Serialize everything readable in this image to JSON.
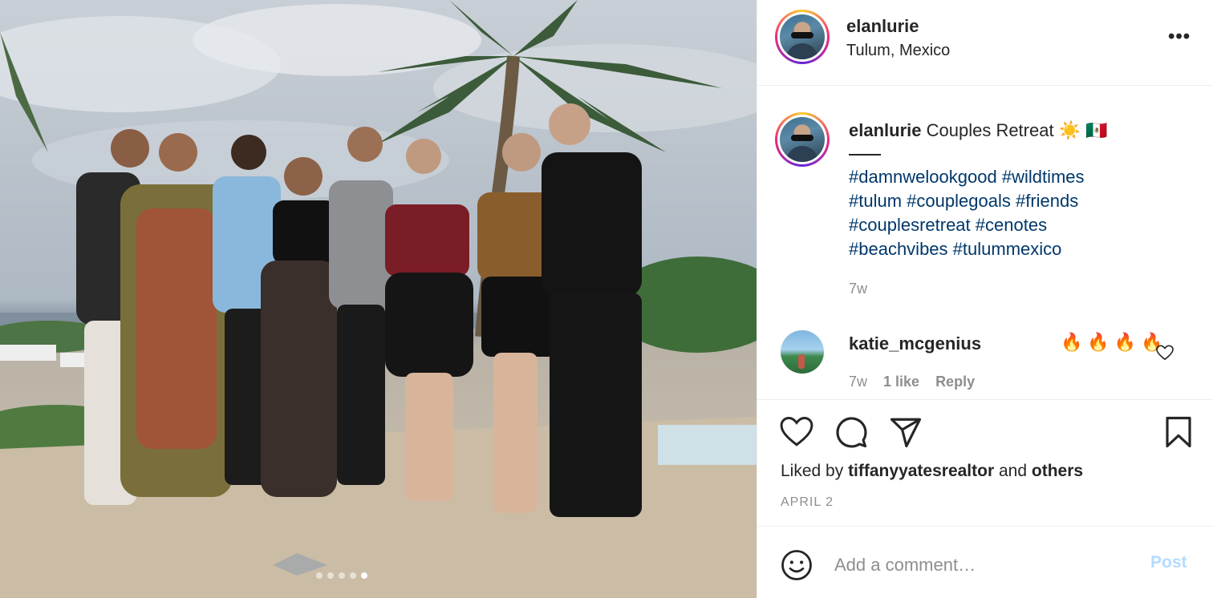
{
  "photo": {
    "carousel_count": 5,
    "carousel_active_index": 4
  },
  "post": {
    "username": "elanlurie",
    "location": "Tulum, Mexico",
    "more_label": "•••",
    "caption_text": "Couples Retreat ☀️ 🇲🇽",
    "hashtags": [
      "#damnwelookgood",
      "#wildtimes",
      "#tulum",
      "#couplegoals",
      "#friends",
      "#couplesretreat",
      "#cenotes",
      "#beachvibes",
      "#tulummexico"
    ],
    "caption_time": "7w"
  },
  "comment": {
    "username": "katie_mcgenius",
    "text": "🔥🔥🔥🔥",
    "time": "7w",
    "likes": "1 like",
    "reply": "Reply"
  },
  "likes_line": {
    "prefix": "Liked by",
    "user": "tiffanyyatesrealtor",
    "conj": "and",
    "others": "others"
  },
  "date": "APRIL 2",
  "add_comment": {
    "placeholder": "Add a comment…",
    "post_label": "Post"
  },
  "colors": {
    "hashtag": "#00376b",
    "post_button_disabled": "#b3dbff",
    "muted": "#8e8e8e"
  }
}
